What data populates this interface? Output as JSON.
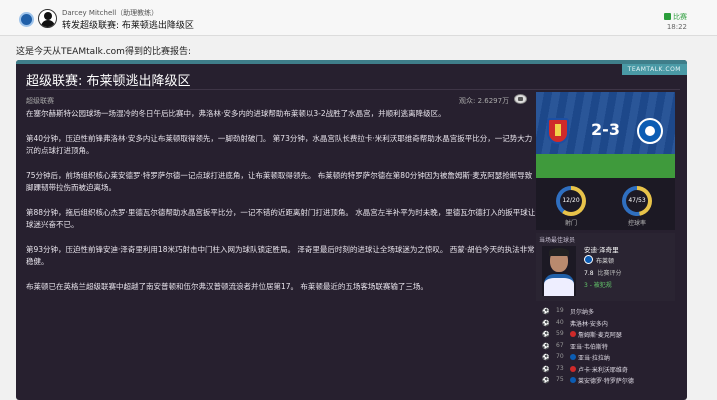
{
  "header": {
    "sender": "Darcey Mitchell（助理教练）",
    "subject": "转发超级联赛: 布莱顿逃出降级区",
    "tag": "比赛",
    "time": "18:22"
  },
  "intro_text": "这是今天从TEAMtalk.com得到的比赛报告:",
  "article": {
    "source_badge": "TEAMTALK.COM",
    "title": "超级联赛: 布莱顿逃出降级区",
    "category": "超级联赛",
    "views": "观众: 2.6297万",
    "paragraphs": [
      "在塞尔赫斯特公园球场一场湿冷的冬日午后比赛中，弗洛林·安多内的进球帮助布莱顿以3-2战胜了水晶宫，并顺利逃离降级区。",
      "第40分钟，压迫性前锋弗洛林·安多内让布莱顿取得领先，一脚劲射破门。 第73分钟，水晶宫队长费拉卡·米利沃耶维奇帮助水晶宫扳平比分，一记势大力沉的点球打进顶角。",
      "75分钟后，前场组织核心莱安德罗·特罗萨尔德一记点球打进底角，让布莱顿取得领先。 布莱顿的特罗萨尔德在第80分钟因为被詹姆斯·麦克阿瑟抢断导致脚踝韧带拉伤而被迫离场。",
      "第88分钟，拖后组织核心杰罗·里德瓦尔德帮助水晶宫扳平比分，一记不错的近距离射门打进顶角。 水晶宫左半补平为时未晚，里德瓦尔德打入的扳平球让球迷兴奋不已。",
      "第93分钟，压迫性前锋安迪·泽奇里利用18米巧射击中门柱入网为球队锁定胜局。 泽奇里最后时刻的进球让全场球迷为之惊叹。 西蒙·胡伯今天的执法非常稳健。",
      "布莱顿已在英格兰超级联赛中超越了南安普顿和伍尔弗汉普顿流浪者并位居第17。 布莱顿最近的五场客场联赛输了三场。"
    ]
  },
  "score_card": {
    "score": "2-3",
    "shots": "12/20",
    "shots_label": "射门",
    "shots_ratio": 0.6,
    "possession": "47/53",
    "possession_label": "控球率",
    "possession_ratio": 0.47
  },
  "player_of_match": {
    "title": "当场最佳球员",
    "name": "安迪·泽奇里",
    "club": "布莱顿",
    "rating": "7.8",
    "rating_label": "比赛评分",
    "assist": "3 - 被犯规"
  },
  "events": [
    {
      "icon": "⚽",
      "icon_color": "#e8c34a",
      "minute": "19",
      "text": "贝尔纳多",
      "badge_color": ""
    },
    {
      "icon": "⚽",
      "icon_color": "#e8c34a",
      "minute": "40",
      "text": "弗洛林·安多内",
      "badge_color": ""
    },
    {
      "icon": "⚽",
      "icon_color": "#e8c34a",
      "minute": "59",
      "text": "詹姆斯·麦克阿瑟",
      "badge_color": "#cf2a2a"
    },
    {
      "icon": "⚽",
      "icon_color": "#e8c34a",
      "minute": "67",
      "text": "亚当·韦伯斯特",
      "badge_color": ""
    },
    {
      "icon": "⚽",
      "icon_color": "#e8c34a",
      "minute": "70",
      "text": "亚当·拉拉纳",
      "badge_color": "#0b5cb3"
    },
    {
      "icon": "⚽",
      "icon_color": "#e8c34a",
      "minute": "73",
      "text": "卢卡·米利沃耶维奇",
      "badge_color": "#cf2a2a"
    },
    {
      "icon": "⚽",
      "icon_color": "#e8c34a",
      "minute": "75",
      "text": "莱安德罗·特罗萨尔德",
      "badge_color": "#0b5cb3"
    }
  ]
}
